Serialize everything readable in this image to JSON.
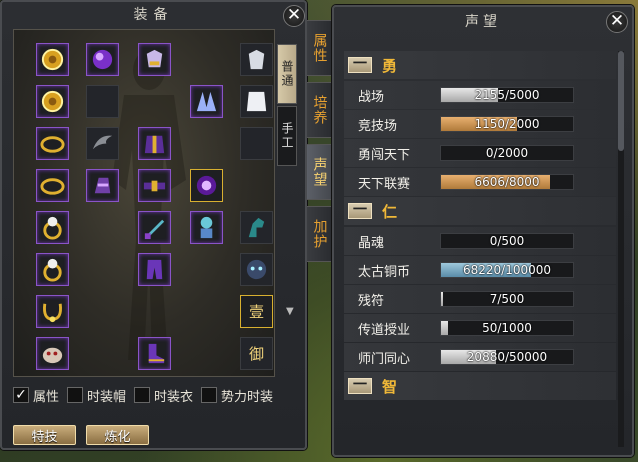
{
  "equipment": {
    "title": "装备",
    "close_glyph": "✕",
    "mode_tabs": [
      "普通",
      "手工"
    ],
    "slot_glyphs": {
      "seal_one": "壹",
      "seal_defend": "御"
    },
    "checkboxes": [
      {
        "label": "属性",
        "checked": true
      },
      {
        "label": "时装帽",
        "checked": false
      },
      {
        "label": "时装衣",
        "checked": false
      },
      {
        "label": "势力时装",
        "checked": false
      }
    ],
    "check_mark": "✓",
    "buttons": [
      "特技",
      "炼化"
    ]
  },
  "side_tabs": [
    {
      "label": "属性",
      "active": false
    },
    {
      "label": "培养",
      "active": false
    },
    {
      "label": "声望",
      "active": true
    },
    {
      "label": "加护",
      "active": false
    }
  ],
  "reputation": {
    "title": "声望",
    "close_glyph": "✕",
    "collapse_glyph": "一",
    "sections": [
      {
        "name": "勇",
        "rows": [
          {
            "label": "战场",
            "text": "2155/5000",
            "value": 2155,
            "max": 5000,
            "style": "silver"
          },
          {
            "label": "竞技场",
            "text": "1150/2000",
            "value": 1150,
            "max": 2000,
            "style": "orange"
          },
          {
            "label": "勇闯天下",
            "text": "0/2000",
            "value": 0,
            "max": 2000,
            "style": "silver"
          },
          {
            "label": "天下联赛",
            "text": "6606/8000",
            "value": 6606,
            "max": 8000,
            "style": "orange"
          }
        ]
      },
      {
        "name": "仁",
        "rows": [
          {
            "label": "晶魂",
            "text": "0/500",
            "value": 0,
            "max": 500,
            "style": "silver"
          },
          {
            "label": "太古铜币",
            "text": "68220/100000",
            "value": 68220,
            "max": 100000,
            "style": "blue"
          },
          {
            "label": "残符",
            "text": "7/500",
            "value": 7,
            "max": 500,
            "style": "silver"
          },
          {
            "label": "传道授业",
            "text": "50/1000",
            "value": 50,
            "max": 1000,
            "style": "silver"
          },
          {
            "label": "师门同心",
            "text": "20880/50000",
            "value": 20880,
            "max": 50000,
            "style": "silver"
          }
        ]
      },
      {
        "name": "智",
        "rows": []
      }
    ]
  },
  "colors": {
    "accent_orange": "#e6a030",
    "section_gold": "#f0b838",
    "item_border_purple": "#8a54c8"
  }
}
